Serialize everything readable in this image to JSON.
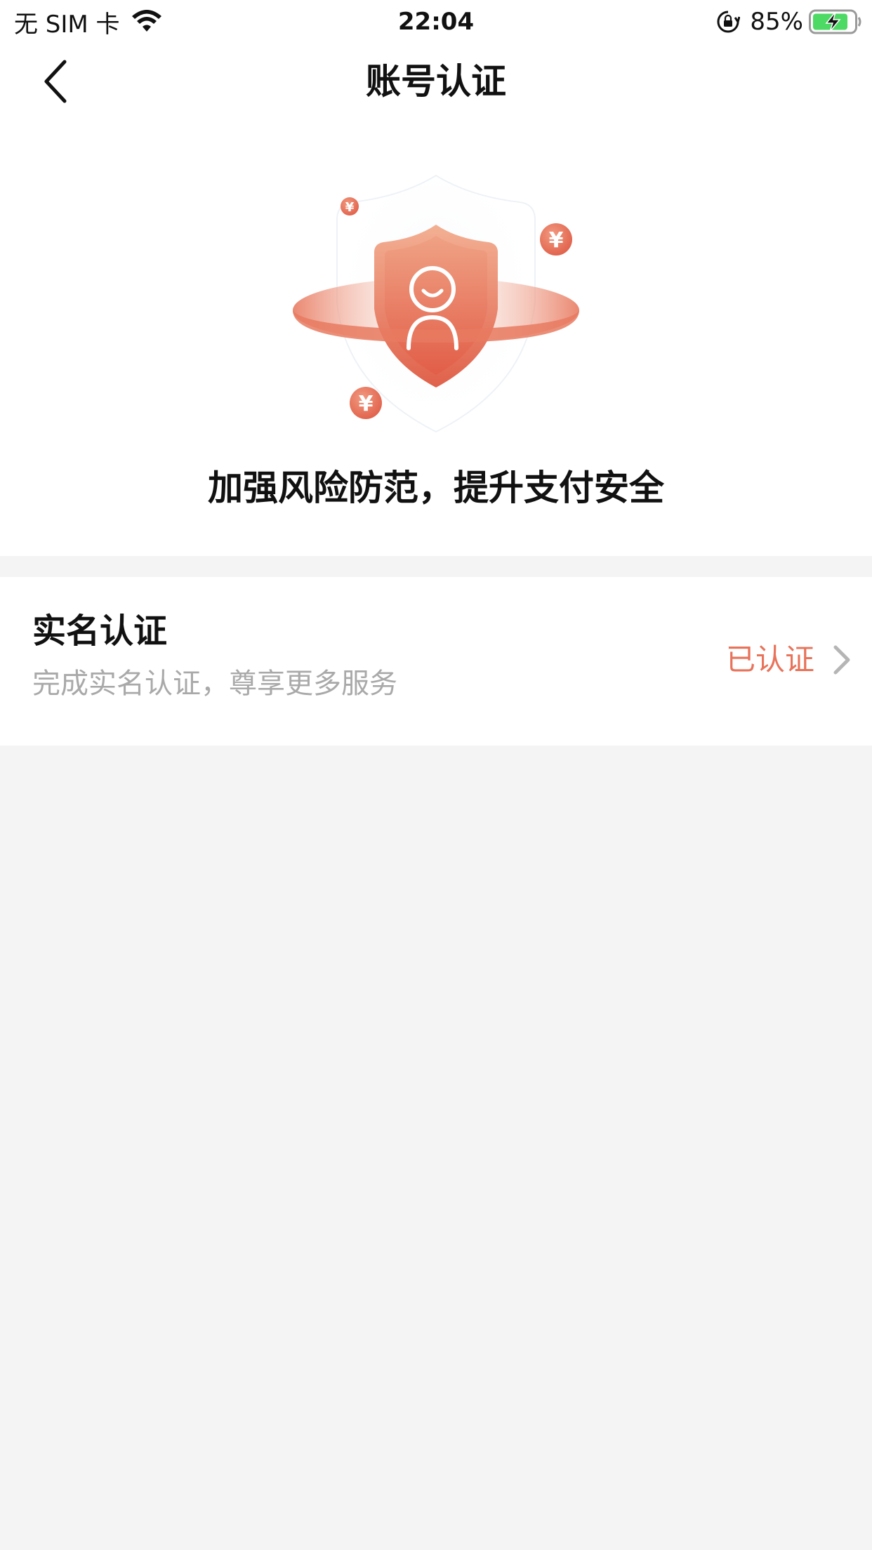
{
  "status_bar": {
    "carrier": "无 SIM 卡",
    "time": "22:04",
    "battery": "85%",
    "icons": [
      "wifi-icon",
      "rotation-lock-icon",
      "battery-charging-icon"
    ]
  },
  "nav": {
    "title": "账号认证",
    "back_icon": "chevron-left-icon"
  },
  "hero": {
    "slogan": "加强风险防范，提升支付安全",
    "coin_symbol": "¥",
    "accent_color": "#e8735a"
  },
  "verify": {
    "title": "实名认证",
    "subtitle": "完成实名认证，尊享更多服务",
    "status": "已认证",
    "status_color": "#e8735a"
  }
}
